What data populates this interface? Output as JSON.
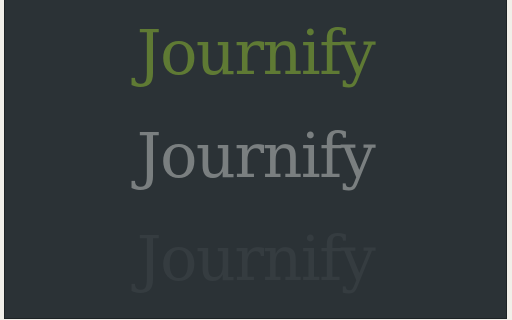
{
  "logo_variants": [
    {
      "text": "Journify",
      "color": "#5f7a34"
    },
    {
      "text": "Journify",
      "color": "#7a7f80"
    },
    {
      "text": "Journify",
      "color": "#353c40"
    }
  ]
}
